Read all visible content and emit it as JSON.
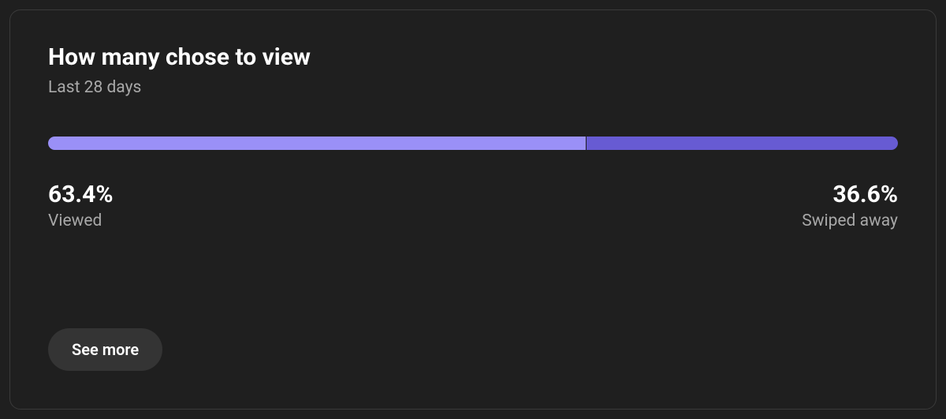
{
  "card": {
    "title": "How many chose to view",
    "subtitle": "Last 28 days",
    "see_more_label": "See more"
  },
  "metrics": {
    "viewed": {
      "value": "63.4%",
      "label": "Viewed"
    },
    "swiped_away": {
      "value": "36.6%",
      "label": "Swiped away"
    }
  },
  "colors": {
    "viewed_bar": "#9a90f7",
    "swiped_bar": "#675bd3"
  },
  "chart_data": {
    "type": "bar",
    "orientation": "horizontal-stacked",
    "title": "How many chose to view",
    "subtitle": "Last 28 days",
    "categories": [
      "Viewed",
      "Swiped away"
    ],
    "values": [
      63.4,
      36.6
    ],
    "unit": "%",
    "xlabel": "",
    "ylabel": "",
    "xlim": [
      0,
      100
    ]
  }
}
